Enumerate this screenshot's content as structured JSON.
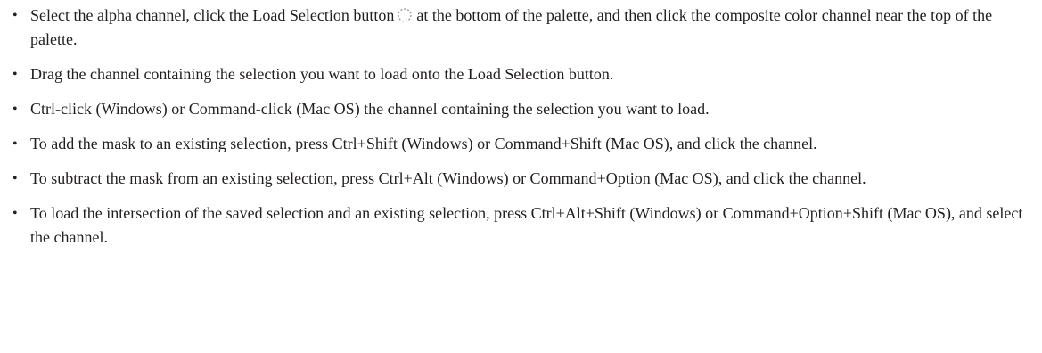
{
  "bullet_glyph": "•",
  "items": [
    {
      "before_icon": "Select the alpha channel, click the Load Selection button",
      "icon": "load-selection-icon",
      "after_icon": "at the bottom of the palette, and then click the composite color channel near the top of the palette."
    },
    {
      "text": "Drag the channel containing the selection you want to load onto the Load Selection button."
    },
    {
      "text": "Ctrl-click (Windows) or Command-click (Mac OS) the channel containing the selection you want to load."
    },
    {
      "text": "To add the mask to an existing selection, press Ctrl+Shift (Windows) or Command+Shift (Mac OS), and click the channel."
    },
    {
      "text": "To subtract the mask from an existing selection, press Ctrl+Alt (Windows) or Command+Option (Mac OS), and click the channel."
    },
    {
      "text": "To load the intersection of the saved selection and an existing selection, press Ctrl+Alt+Shift (Windows) or Command+Option+Shift (Mac OS), and select the channel."
    }
  ]
}
